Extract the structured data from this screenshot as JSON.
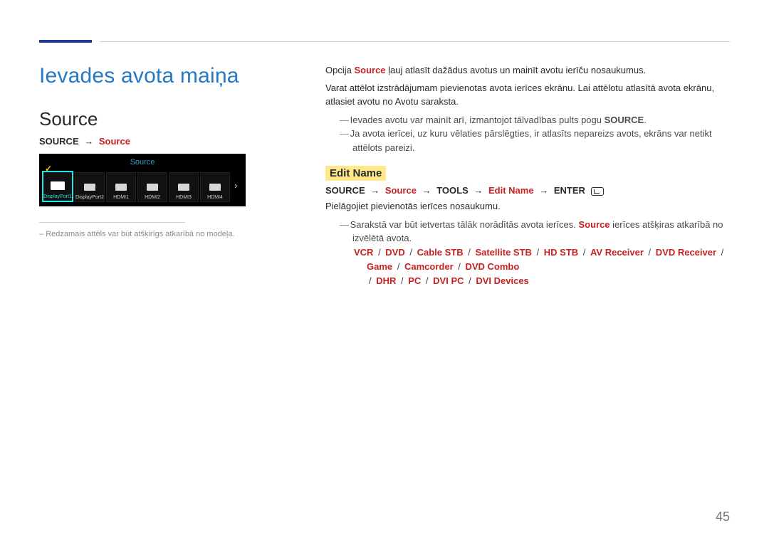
{
  "page_number": "45",
  "chapter_title": "Ievades avota maiņa",
  "section_title": "Source",
  "source_path": {
    "p1": "SOURCE",
    "arrow": "→",
    "p2": "Source"
  },
  "figure": {
    "header": "Source",
    "tiles": [
      {
        "name": "DisplayPort1",
        "active": true
      },
      {
        "name": "DisplayPort2",
        "active": false
      },
      {
        "name": "HDMI1",
        "active": false
      },
      {
        "name": "HDMI2",
        "active": false
      },
      {
        "name": "HDMI3",
        "active": false
      },
      {
        "name": "HDMI4",
        "active": false
      }
    ],
    "chevron": "›"
  },
  "footnote": "Redzamais attēls var būt atšķirīgs atkarībā no modeļa.",
  "intro": {
    "line1a": "Opcija ",
    "line1b": "Source",
    "line1c": " ļauj atlasīt dažādus avotus un mainīt avotu ierīču nosaukumus.",
    "line2": "Varat attēlot izstrādājumam pievienotas avota ierīces ekrānu. Lai attēlotu atlasītā avota ekrānu, atlasiet avotu no Avotu saraksta."
  },
  "notes1": [
    {
      "pre": "Ievades avotu var mainīt arī, izmantojot tālvadības pults pogu ",
      "bold": "SOURCE",
      "post": "."
    },
    {
      "pre": "Ja avota ierīcei, uz kuru vēlaties pārslēgties, ir atlasīts nepareizs avots, ekrāns var netikt attēlots pareizi.",
      "bold": "",
      "post": ""
    }
  ],
  "edit_name": {
    "heading": "Edit Name",
    "path": {
      "p1": "SOURCE",
      "p2": "Source",
      "p3": "TOOLS",
      "p4": "Edit Name",
      "p5": "ENTER",
      "arrow": "→"
    },
    "desc": "Pielāgojiet pievienotās ierīces nosaukumu.",
    "note_pre": "Sarakstā var būt ietvertas tālāk norādītās avota ierīces. ",
    "note_src": "Source",
    "note_post": " ierīces atšķiras atkarībā no izvēlētā avota.",
    "options": [
      "VCR",
      "DVD",
      "Cable STB",
      "Satellite STB",
      "HD STB",
      "AV Receiver",
      "DVD Receiver",
      "Game",
      "Camcorder",
      "DVD Combo",
      "DHR",
      "PC",
      "DVI PC",
      "DVI Devices"
    ]
  }
}
